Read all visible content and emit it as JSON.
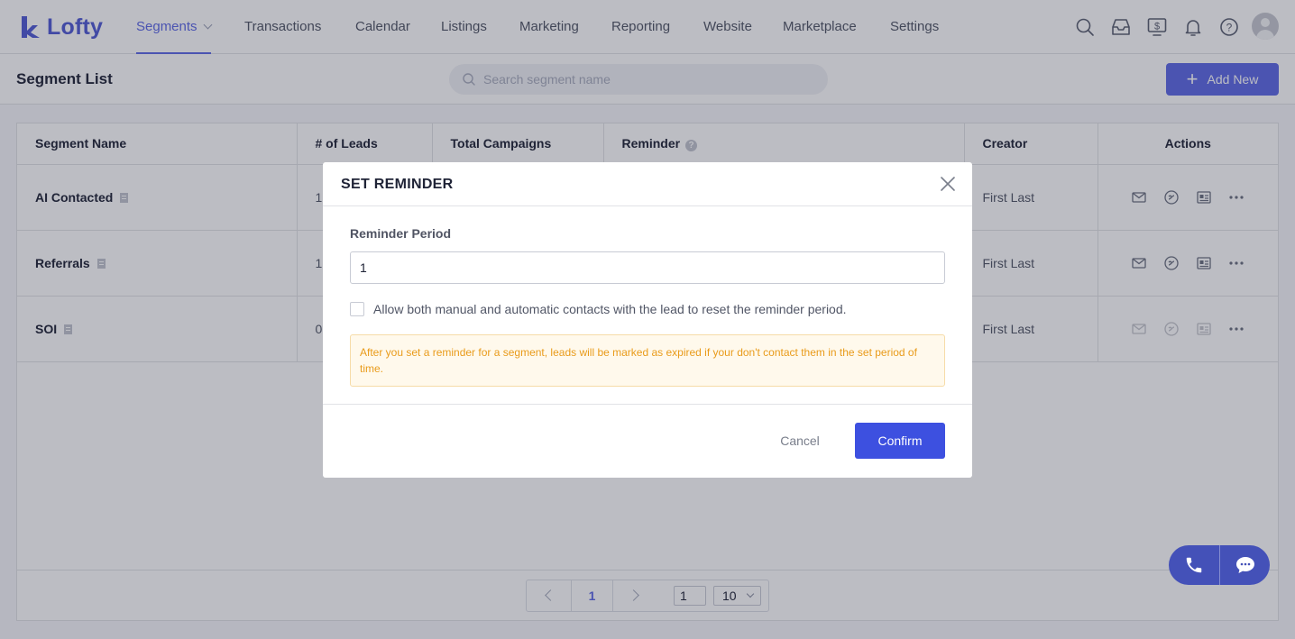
{
  "brand": {
    "name": "Lofty",
    "color": "#515bd4"
  },
  "nav": {
    "items": [
      {
        "label": "Segments",
        "active": true
      },
      {
        "label": "Transactions"
      },
      {
        "label": "Calendar"
      },
      {
        "label": "Listings"
      },
      {
        "label": "Marketing"
      },
      {
        "label": "Reporting"
      },
      {
        "label": "Website"
      },
      {
        "label": "Marketplace"
      },
      {
        "label": "Settings"
      }
    ],
    "icons": [
      "search-icon",
      "inbox-icon",
      "dollar-screen-icon",
      "bell-icon",
      "help-icon",
      "avatar"
    ]
  },
  "header": {
    "title": "Segment List",
    "search_placeholder": "Search segment name",
    "add_label": "Add New"
  },
  "table": {
    "columns": [
      "Segment Name",
      "# of Leads",
      "Total Campaigns",
      "Reminder",
      "Creator",
      "Actions"
    ],
    "rows": [
      {
        "name": "AI Contacted",
        "leads": "1",
        "creator": "First Last",
        "actions_enabled": true
      },
      {
        "name": "Referrals",
        "leads": "1",
        "creator": "First Last",
        "actions_enabled": true
      },
      {
        "name": "SOI",
        "leads": "0",
        "creator": "First Last",
        "actions_enabled": false
      }
    ]
  },
  "pagination": {
    "current": "1",
    "jump_value": "1",
    "page_size": "10"
  },
  "modal": {
    "title": "SET REMINDER",
    "field_label": "Reminder Period",
    "field_value": "1",
    "checkbox_label": "Allow both manual and automatic contacts with the lead to reset the reminder period.",
    "checkbox_checked": false,
    "notice": "After you set a reminder for a segment, leads will be marked as expired if your don't contact them in the set period of time.",
    "cancel_label": "Cancel",
    "confirm_label": "Confirm"
  },
  "colors": {
    "accent": "#5d69e6",
    "confirm": "#3d50e0",
    "notice_text": "#e99b1a"
  }
}
